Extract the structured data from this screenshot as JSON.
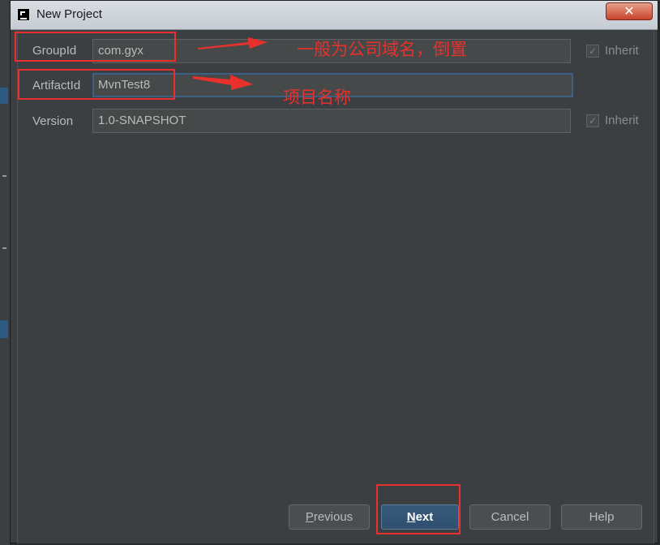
{
  "window": {
    "title": "New Project",
    "close_glyph": "✕"
  },
  "fields": [
    {
      "label": "GroupId",
      "value": "com.gyx",
      "inherit": true
    },
    {
      "label": "ArtifactId",
      "value": "MvnTest8",
      "inherit": null
    },
    {
      "label": "Version",
      "value": "1.0-SNAPSHOT",
      "inherit": true
    }
  ],
  "inherit_label": "Inherit",
  "annotations": {
    "groupid_note": "一般为公司域名，倒置",
    "artifactid_note": "项目名称"
  },
  "buttons": {
    "previous": {
      "mnemonic": "P",
      "rest": "revious"
    },
    "next": {
      "mnemonic": "N",
      "rest": "ext"
    },
    "cancel": "Cancel",
    "help": "Help"
  },
  "colors": {
    "annotation": "#e8312d",
    "accent": "#375a7c",
    "focus": "#3d6185"
  }
}
